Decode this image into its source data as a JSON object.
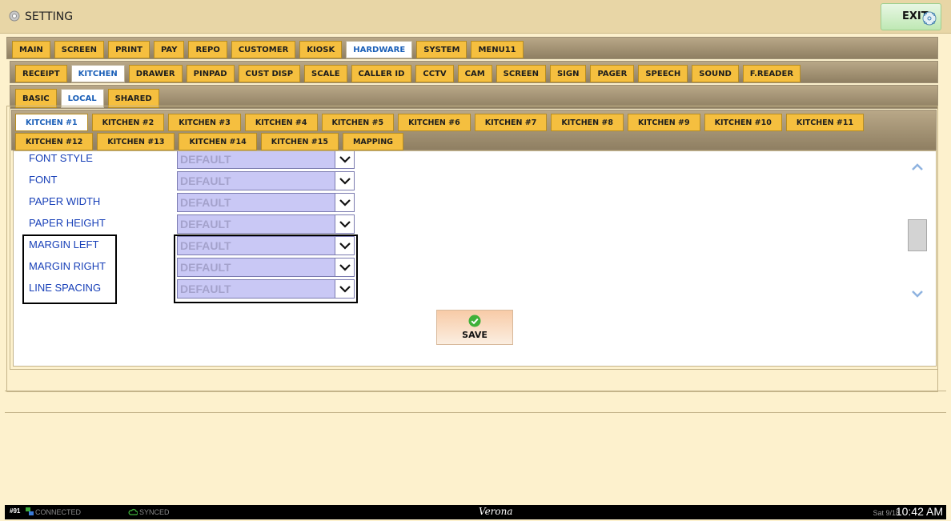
{
  "app": {
    "title": "SETTING",
    "exit_label": "EXIT"
  },
  "tabs_main": [
    "MAIN",
    "SCREEN",
    "PRINT",
    "PAY",
    "REPO",
    "CUSTOMER",
    "KIOSK",
    "HARDWARE",
    "SYSTEM",
    "MENU11"
  ],
  "tabs_main_active": "HARDWARE",
  "tabs_hardware": [
    "RECEIPT",
    "KITCHEN",
    "DRAWER",
    "PINPAD",
    "CUST DISP",
    "SCALE",
    "CALLER ID",
    "CCTV",
    "CAM",
    "SCREEN",
    "SIGN",
    "PAGER",
    "SPEECH",
    "SOUND",
    "F.READER"
  ],
  "tabs_hardware_active": "KITCHEN",
  "tabs_scope": [
    "BASIC",
    "LOCAL",
    "SHARED"
  ],
  "tabs_scope_active": "LOCAL",
  "tabs_kitchen": [
    "KITCHEN #1",
    "KITCHEN #2",
    "KITCHEN #3",
    "KITCHEN #4",
    "KITCHEN #5",
    "KITCHEN #6",
    "KITCHEN #7",
    "KITCHEN #8",
    "KITCHEN #9",
    "KITCHEN #10",
    "KITCHEN #11",
    "KITCHEN #12",
    "KITCHEN #13",
    "KITCHEN #14",
    "KITCHEN #15",
    "MAPPING"
  ],
  "tabs_kitchen_active": "KITCHEN #1",
  "settings": [
    {
      "label": "FONT STYLE",
      "value": "DEFAULT"
    },
    {
      "label": "FONT",
      "value": "DEFAULT"
    },
    {
      "label": "PAPER WIDTH",
      "value": "DEFAULT"
    },
    {
      "label": "PAPER HEIGHT",
      "value": "DEFAULT"
    },
    {
      "label": "MARGIN LEFT",
      "value": "DEFAULT"
    },
    {
      "label": "MARGIN RIGHT",
      "value": "DEFAULT"
    },
    {
      "label": "LINE SPACING",
      "value": "DEFAULT"
    }
  ],
  "save_label": "SAVE",
  "status": {
    "station": "#91",
    "connection": "CONNECTED",
    "sync": "SYNCED",
    "store": "Verona",
    "date": "Sat 9/18",
    "time": "10:42 AM"
  },
  "colors": {
    "tab": "#f5bf3f",
    "tab_active_text": "#1a5fb8",
    "label": "#1840b8",
    "select_bg": "#c9c8f5",
    "save_icon": "#3fb13a"
  }
}
